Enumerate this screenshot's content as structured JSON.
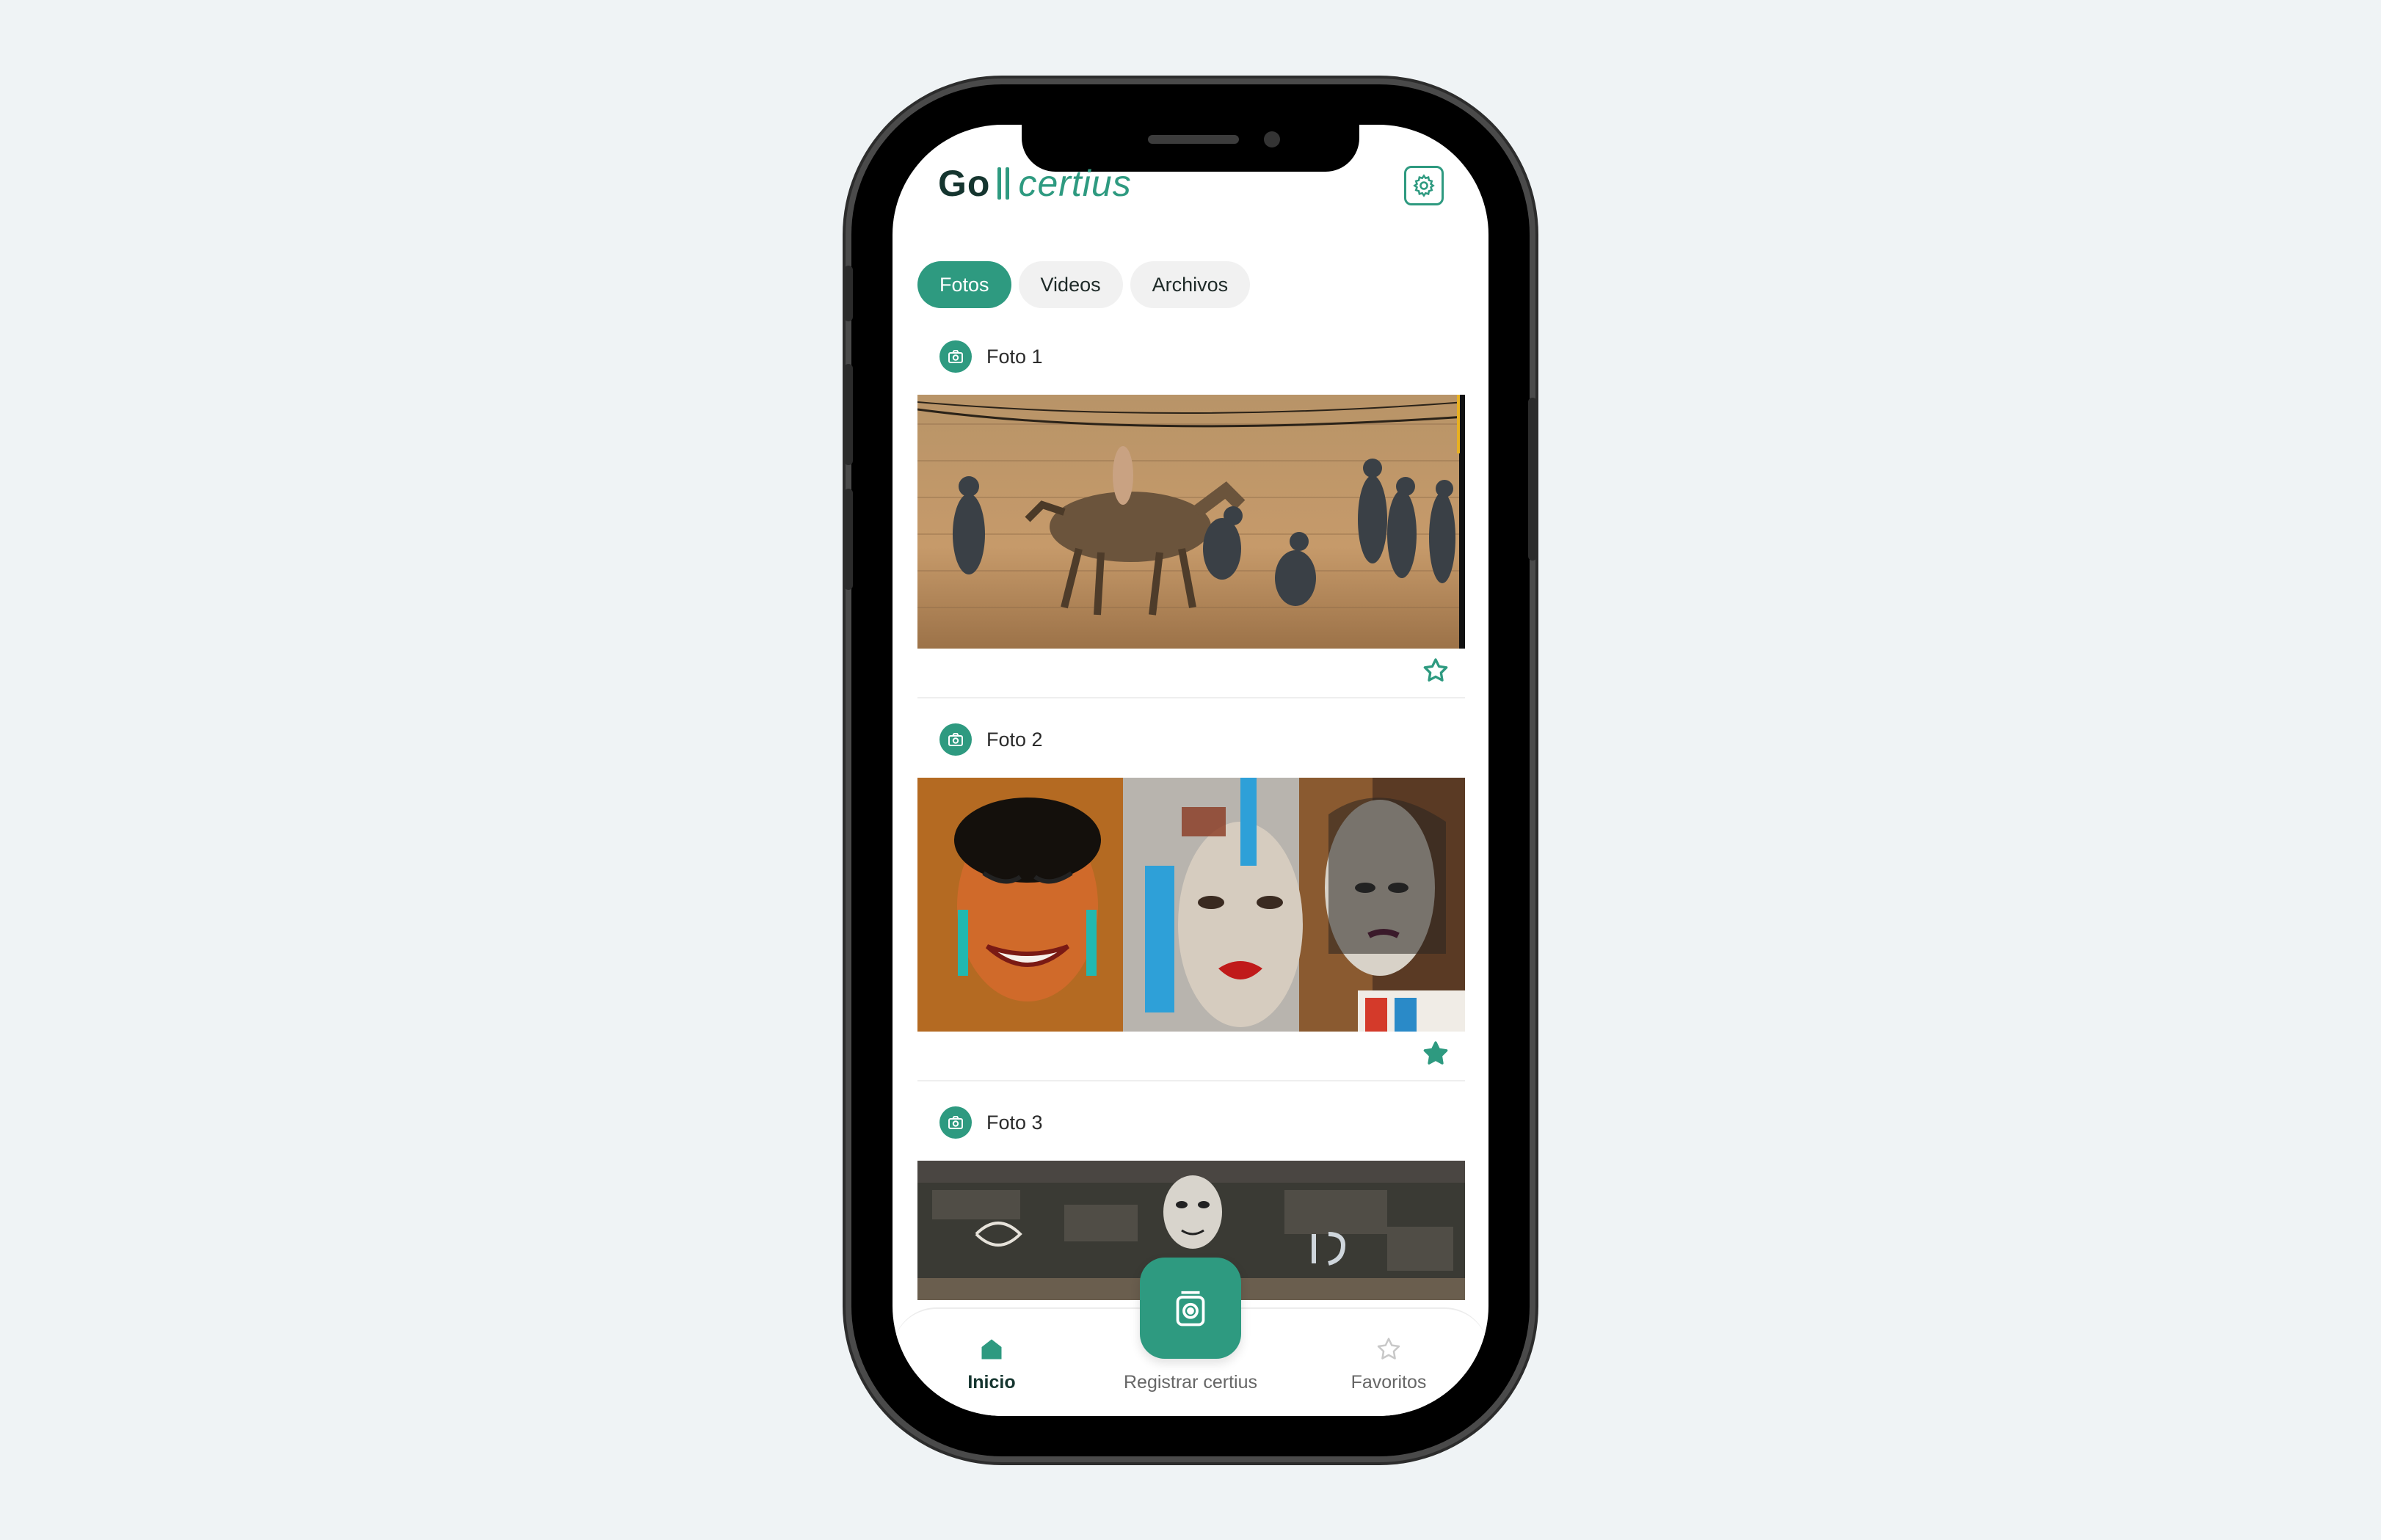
{
  "app": {
    "logo_go": "Go",
    "logo_certius": "certius"
  },
  "tabs": [
    {
      "label": "Fotos",
      "active": true
    },
    {
      "label": "Videos",
      "active": false
    },
    {
      "label": "Archivos",
      "active": false
    }
  ],
  "photos": [
    {
      "title": "Foto 1",
      "favorite": false
    },
    {
      "title": "Foto 2",
      "favorite": true
    },
    {
      "title": "Foto 3",
      "favorite": false
    }
  ],
  "nav": {
    "home_label": "Inicio",
    "register_label": "Registrar certius",
    "favorites_label": "Favoritos"
  },
  "colors": {
    "accent": "#2e9a80",
    "dark_text": "#15352f",
    "background": "#eff3f5"
  }
}
